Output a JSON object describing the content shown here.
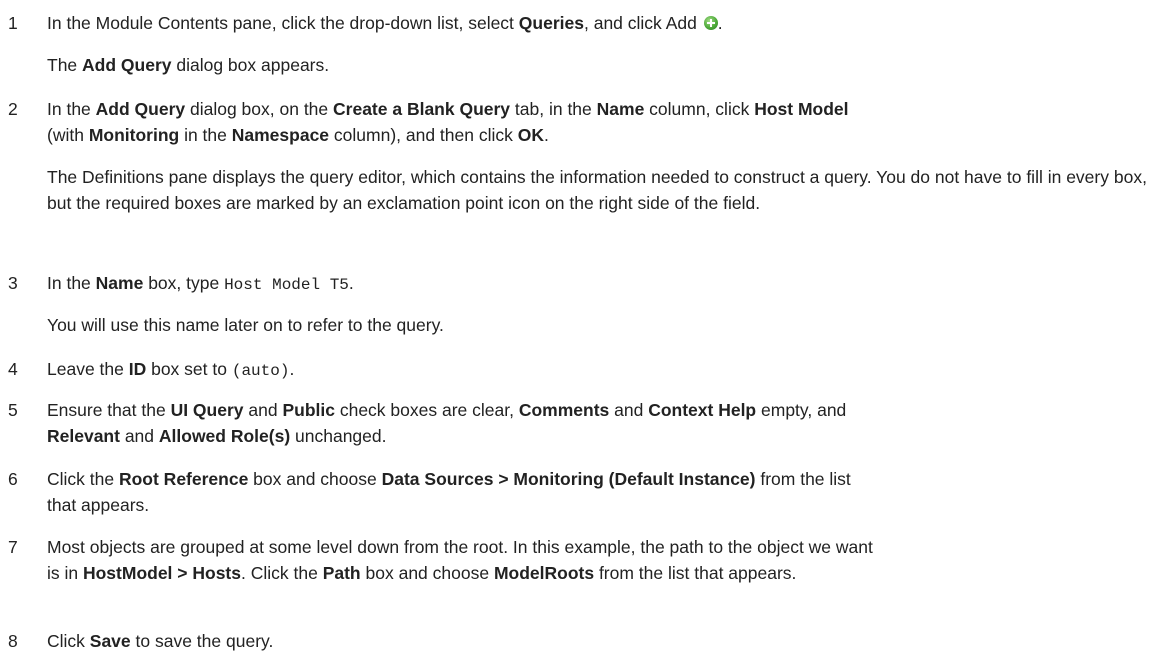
{
  "steps": [
    {
      "num": "1",
      "t1": "In the Module Contents pane, click the drop-down list, select ",
      "b1": "Queries",
      "t2": ", and click Add ",
      "t3": ".",
      "add_icon": "add-plus-circle-icon",
      "note": {
        "t1": "The ",
        "b1": "Add Query",
        "t2": " dialog box appears."
      }
    },
    {
      "num": "2",
      "t1": "In the ",
      "b1": "Add Query",
      "t2": " dialog box, on the ",
      "b2": "Create a Blank Query",
      "t3": " tab, in the ",
      "b3": "Name",
      "t4": " column, click ",
      "b4": "Host Model",
      "t5": "(with ",
      "b5": "Monitoring",
      "t6": " in the ",
      "b6": "Namespace",
      "t7": " column), and then click ",
      "b7": "OK",
      "t8": ".",
      "note": "The Definitions pane displays the query editor, which contains the information needed to construct a query. You do not have to fill in every box, but the required boxes are marked by an exclamation point icon on the right side of the field."
    },
    {
      "num": "3",
      "t1": "In the ",
      "b1": "Name",
      "t2": " box, type ",
      "c1": "Host Model T5",
      "t3": ".",
      "note": "You will use this name later on to refer to the query."
    },
    {
      "num": "4",
      "t1": "Leave the ",
      "b1": "ID",
      "t2": " box set to ",
      "c1": "(auto)",
      "t3": "."
    },
    {
      "num": "5",
      "t1": "Ensure that the ",
      "b1": "UI Query",
      "t2": " and ",
      "b2": "Public",
      "t3": " check boxes are clear, ",
      "b3": "Comments",
      "t4": " and ",
      "b4": "Context Help",
      "t5": " empty, and",
      "b5": "Relevant",
      "t6": " and ",
      "b6": "Allowed Role(s)",
      "t7": " unchanged."
    },
    {
      "num": "6",
      "t1": "Click the ",
      "b1": "Root Reference",
      "t2": " box and choose ",
      "b2": "Data Sources > Monitoring (Default Instance)",
      "t3": " from the list",
      "t4": "that appears."
    },
    {
      "num": "7",
      "t1": "Most objects are grouped at some level down from the root. In this example, the path to the object we want",
      "t2": "is in ",
      "b1": "HostModel > Hosts",
      "t3": ". Click the ",
      "b2": "Path",
      "t4": " box and choose ",
      "b3": "ModelRoots",
      "t5": " from the list that appears."
    },
    {
      "num": "8",
      "t1": "Click ",
      "b1": "Save",
      "t2": " to save the query."
    }
  ]
}
